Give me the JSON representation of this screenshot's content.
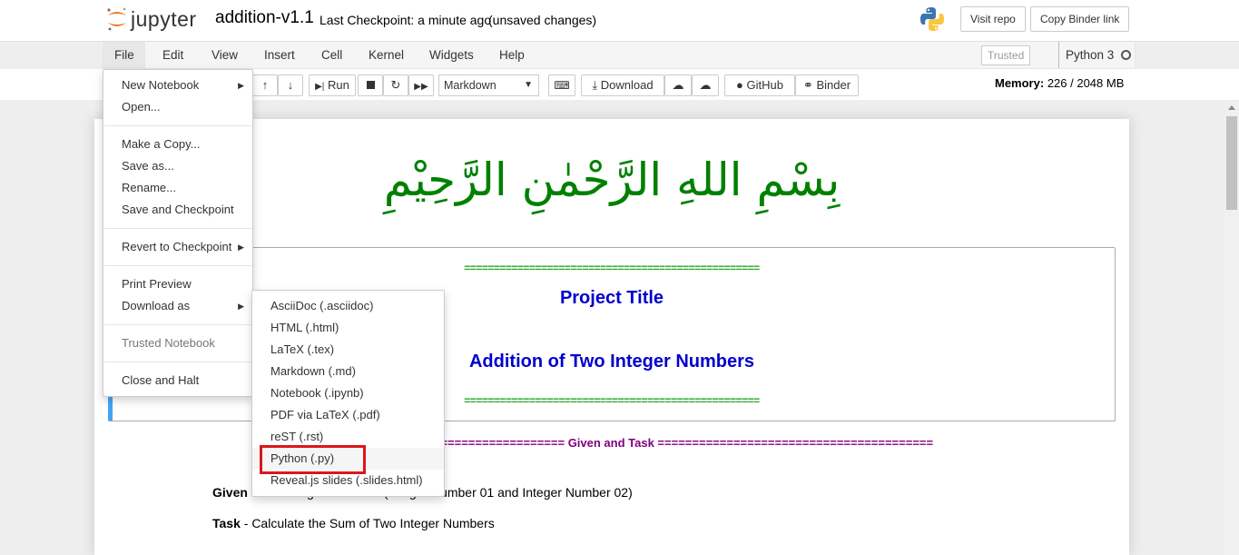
{
  "header": {
    "logo_text": "jupyter",
    "notebook_name": "addition-v1.1",
    "checkpoint": "Last Checkpoint: a minute ago",
    "autosave": "(unsaved changes)",
    "visit_repo": "Visit repo",
    "copy_binder": "Copy Binder link"
  },
  "menubar": {
    "items": [
      "File",
      "Edit",
      "View",
      "Insert",
      "Cell",
      "Kernel",
      "Widgets",
      "Help"
    ],
    "trusted": "Trusted",
    "kernel": "Python 3"
  },
  "toolbar": {
    "run": "Run",
    "cell_type": "Markdown",
    "download": "Download",
    "github": "GitHub",
    "binder": "Binder",
    "memory_label": "Memory:",
    "memory_value": "226 / 2048 MB"
  },
  "file_menu": {
    "new_notebook": "New Notebook",
    "open": "Open...",
    "make_copy": "Make a Copy...",
    "save_as": "Save as...",
    "rename": "Rename...",
    "save_checkpoint": "Save and Checkpoint",
    "revert": "Revert to Checkpoint",
    "print_preview": "Print Preview",
    "download_as": "Download as",
    "trusted_notebook": "Trusted Notebook",
    "close_halt": "Close and Halt"
  },
  "download_menu": {
    "items": [
      "AsciiDoc (.asciidoc)",
      "HTML (.html)",
      "LaTeX (.tex)",
      "Markdown (.md)",
      "Notebook (.ipynb)",
      "PDF via LaTeX (.pdf)",
      "reST (.rst)",
      "Python (.py)",
      "Reveal.js slides (.slides.html)"
    ]
  },
  "notebook": {
    "bismillah": "بِسْمِ اللهِ الرَّحْمٰنِ الرَّحِيْمِ",
    "equals_line": "==================================================",
    "project_title": "Project Title",
    "project_subtitle": "Addition of Two Integer Numbers",
    "given_task_divider": "======================== Given and Task ========================================",
    "given_label": "Given",
    "given_text": " - Two Integer Numbers (Integer Number 01 and Integer Number 02)",
    "task_label": "Task",
    "task_text": " - Calculate the Sum of Two Integer Numbers"
  },
  "colors": {
    "bismillah_green": "#008000",
    "title_blue": "#0000cc",
    "divider_purple": "#800080",
    "selected_cell_blue": "#42a5f5",
    "highlight_red": "#d9181b"
  }
}
